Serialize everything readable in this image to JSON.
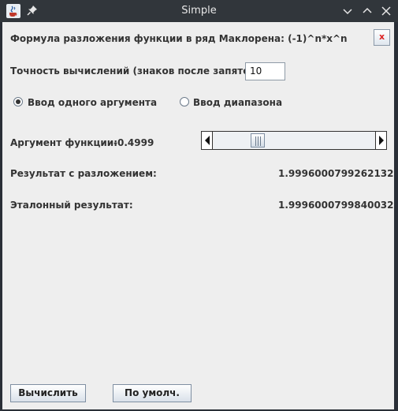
{
  "window": {
    "title": "Simple"
  },
  "form": {
    "formula_label": "Формула разложения функции в ряд Маклорена: (-1)^n*x^n",
    "close_label": "x",
    "precision_label": "Точность вычислений (знаков после запятой):",
    "precision_value": "10",
    "mode_single_label": "Ввод одного аргумента",
    "mode_range_label": "Ввод диапазона",
    "selected_mode": "single",
    "argument_label": "Аргумент функции:",
    "argument_value": "-0.4999",
    "slider_level": 0.25,
    "series_result_label": "Результат с разложением:",
    "series_result_value": "1.9996000799262132",
    "reference_result_label": "Эталонный результат:",
    "reference_result_value": "1.9996000799840032"
  },
  "buttons": {
    "calculate_label": "Вычислить",
    "default_label": "По умолч."
  },
  "icons": {
    "app": "java-cup-icon",
    "pin": "pin-icon",
    "minimize": "chevron-down-icon",
    "maximize": "chevron-up-icon",
    "close": "close-icon"
  }
}
